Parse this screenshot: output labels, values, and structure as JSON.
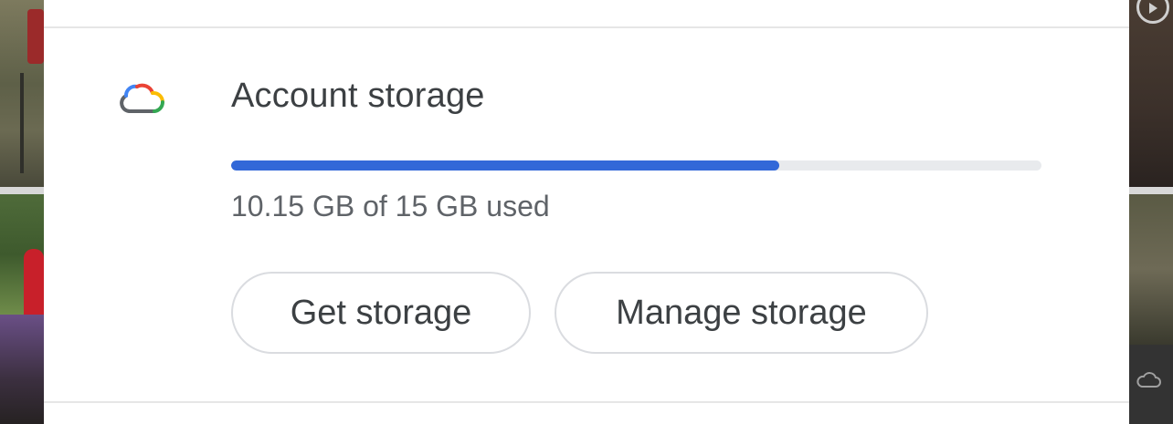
{
  "storage": {
    "title": "Account storage",
    "usage_text": "10.15 GB of 15 GB used",
    "used_gb": 10.15,
    "total_gb": 15,
    "used_fraction": 0.6767
  },
  "buttons": {
    "get_storage": "Get storage",
    "manage_storage": "Manage storage"
  },
  "icons": {
    "cloud": "cloud-icon",
    "play": "play-icon"
  },
  "colors": {
    "progress_fill": "#3268d8",
    "progress_track": "#e8eaed",
    "title": "#3c4043",
    "secondary_text": "#5f6368",
    "cloud_red": "#ea4335",
    "cloud_yellow": "#fbbc04",
    "cloud_green": "#34a853",
    "cloud_blue": "#4285f4",
    "cloud_grey": "#5f6368"
  }
}
